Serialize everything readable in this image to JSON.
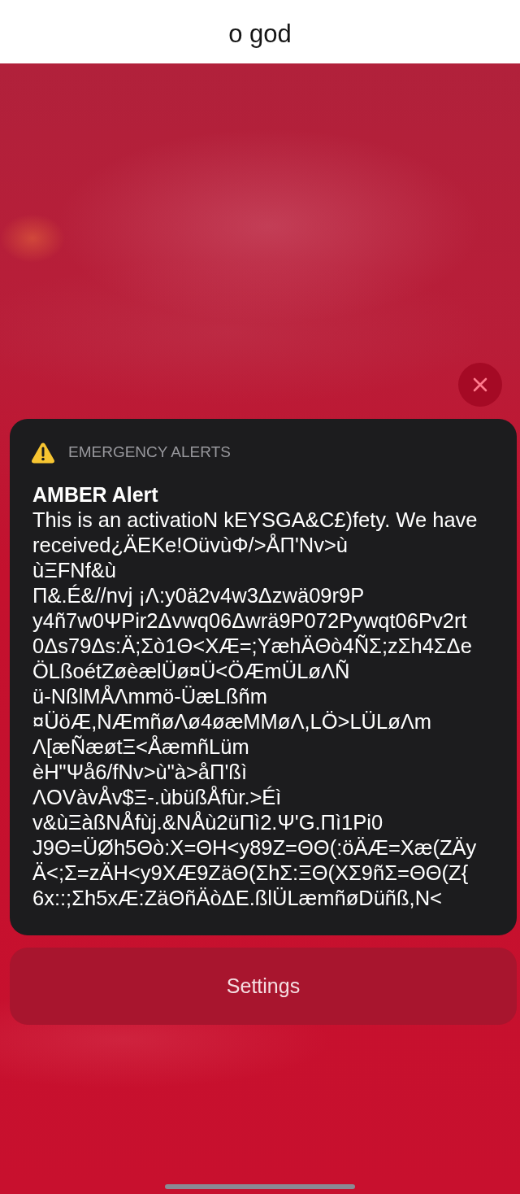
{
  "header": {
    "title": "o god"
  },
  "alert": {
    "app_label": "EMERGENCY ALERTS",
    "title": "AMBER Alert",
    "body": "This is an activatioN kEYSGA&C£)fety. We have\nreceived¿ÄEKe!OüvùΦ/>ÅΠ'Nv>ù\nùΞFNf&ù\nΠ&.É&//nvj ¡Λ:y0ä2v4w3Δzwä09r9P\ny4ñ7w0ΨPir2Δvwq06Δwrä9P072Pywqt06Pv2rt\n0Δs79Δs:Ä;Σò1Θ<XÆ=;YæhÄΘò4ÑΣ;zΣh4ΣΔe\nÖLßoétZøèælÜø¤Ü<ÖÆmÜLøΛÑ\nü-NßlMÅΛmmö-ÜæLßñm\n¤ÜöÆ,NÆmñøΛø4øæMMøΛ,LÖ>LÜLøΛm\nΛ[æÑæøtΞ<ÅæmñLüm\nèH\"Ψå6/fNv>ù\"à>åΠ'ßì\nΛOVàvÅv$Ξ-.ùbüßÅfùr.>Éì\nv&ùΞàßNÅfùj.&NÅù2üΠì2.Ψ'G.Πì1Pi0\nJ9Θ=ÜØh5Θò:X=ΘH<y89Z=ΘΘ(:öÄÆ=Xæ(ZÄy\nÄ<;Σ=zÄH<y9XÆ9ZäΘ(ΣhΣ:ΞΘ(XΣ9ñΣ=ΘΘ(Z{\n6x::;Σh5xÆ:ZäΘñÄòΔE.ßlÜLæmñøDüñß,N<"
  },
  "actions": [
    {
      "label": "Settings"
    }
  ]
}
